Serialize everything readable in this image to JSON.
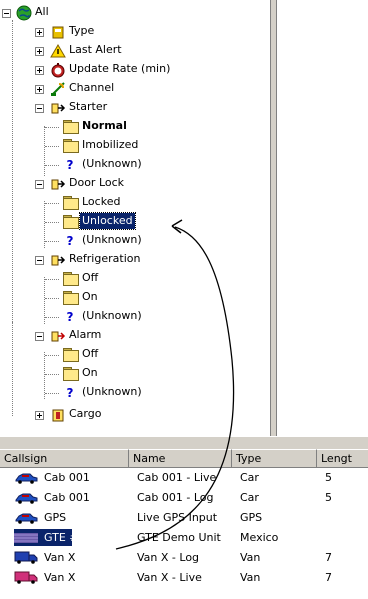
{
  "tree": {
    "root": {
      "label": "All",
      "icon": "globe-icon"
    },
    "groups": [
      {
        "label": "Type",
        "icon": "vehicle-type-icon",
        "expanded": false
      },
      {
        "label": "Last Alert",
        "icon": "alert-icon",
        "expanded": false
      },
      {
        "label": "Update Rate (min)",
        "icon": "stopwatch-icon",
        "expanded": false
      },
      {
        "label": "Channel",
        "icon": "antenna-icon",
        "expanded": false
      },
      {
        "label": "Starter",
        "icon": "starter-icon",
        "expanded": true,
        "children": [
          "Normal",
          "Imobilized",
          "(Unknown)"
        ]
      },
      {
        "label": "Door Lock",
        "icon": "door-lock-icon",
        "expanded": true,
        "children": [
          "Locked",
          "Unlocked",
          "(Unknown)"
        ]
      },
      {
        "label": "Refrigeration",
        "icon": "refrigeration-icon",
        "expanded": true,
        "children": [
          "Off",
          "On",
          "(Unknown)"
        ]
      },
      {
        "label": "Alarm",
        "icon": "alarm-icon",
        "expanded": true,
        "children": [
          "Off",
          "On",
          "(Unknown)"
        ]
      },
      {
        "label": "Cargo",
        "icon": "cargo-icon",
        "expanded": false
      }
    ],
    "selected": "Unlocked",
    "bold_item": "Normal"
  },
  "list": {
    "columns": [
      "Callsign",
      "Name",
      "Type",
      "Lengt"
    ],
    "rows": [
      {
        "callsign": "Cab 001",
        "name": "Cab 001 - Live",
        "type": "Car",
        "length": "5",
        "icon": "car-icon"
      },
      {
        "callsign": "Cab 001",
        "name": "Cab 001 - Log",
        "type": "Car",
        "length": "5",
        "icon": "car-icon"
      },
      {
        "callsign": "GPS",
        "name": "Live GPS Input",
        "type": "GPS",
        "length": "",
        "icon": "car-icon"
      },
      {
        "callsign": "GTE #1",
        "name": "GTE Demo Unit",
        "type": "Mexico",
        "length": "",
        "icon": "selected-row-icon"
      },
      {
        "callsign": "Van X",
        "name": "Van X - Log",
        "type": "Van",
        "length": "7",
        "icon": "van-blue-icon"
      },
      {
        "callsign": "Van X",
        "name": "Van X - Live",
        "type": "Van",
        "length": "7",
        "icon": "van-pink-icon"
      }
    ]
  },
  "colors": {
    "selection": "#0a246a",
    "folder": "#ffe98a",
    "unknown": "#0000cc",
    "car": "#2050c0",
    "van_blue": "#2040b0",
    "van_pink": "#d0307a"
  }
}
